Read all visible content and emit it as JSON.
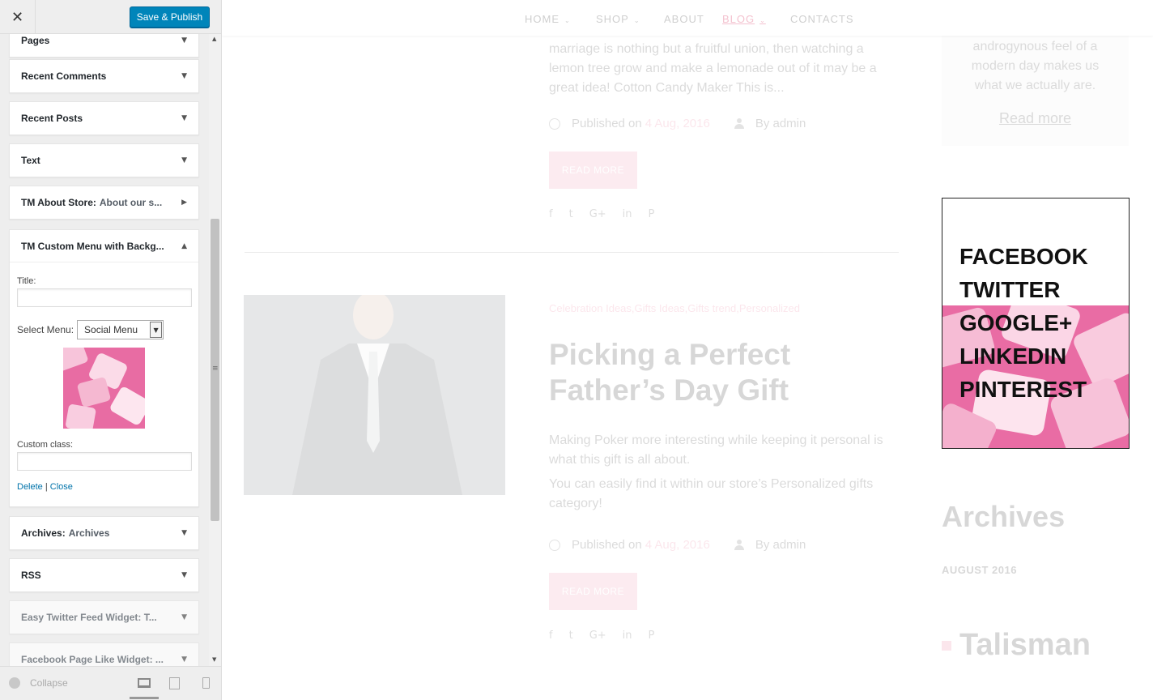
{
  "panel": {
    "close_label": "✕",
    "save_label": "Save & Publish",
    "widgets": {
      "pages": "Pages",
      "recent_comments": "Recent Comments",
      "recent_posts": "Recent Posts",
      "text": "Text",
      "tm_about_store": "TM About Store:",
      "tm_about_store_sub": "About our s...",
      "tm_custom_menu": "TM Custom Menu with Backg...",
      "archives": "Archives:",
      "archives_sub": "Archives",
      "rss": "RSS",
      "easy_twitter": "Easy Twitter Feed Widget: T...",
      "facebook_page": "Facebook Page Like Widget: ..."
    },
    "form": {
      "title_label": "Title:",
      "title_value": "",
      "select_menu_label": "Select Menu:",
      "select_menu_value": "Social Menu",
      "custom_class_label": "Custom class:",
      "custom_class_value": "",
      "delete_label": "Delete",
      "separator": "|",
      "close_label": "Close"
    },
    "footer": {
      "collapse_label": "Collapse"
    }
  },
  "site": {
    "nav": [
      {
        "label": "HOME",
        "has_dropdown": true
      },
      {
        "label": "SHOP",
        "has_dropdown": true
      },
      {
        "label": "ABOUT",
        "has_dropdown": false
      },
      {
        "label": "BLOG",
        "has_dropdown": true,
        "active": true
      },
      {
        "label": "CONTACTS",
        "has_dropdown": false
      }
    ],
    "post1": {
      "excerpt": "marriage is nothing but a fruitful union, then watching a lemon tree grow and make a lemonade out of it may be a great idea!  Cotton Candy Maker This is...",
      "published_label": "Published on",
      "date": "4 Aug, 2016",
      "author": "By admin",
      "read_more": "READ MORE"
    },
    "post2": {
      "categories": "Celebration Ideas,Gifts Ideas,Gifts trend,Personalized",
      "title": "Picking a Perfect Father’s Day Gift",
      "para1": "Making Poker more interesting while keeping it personal is what this gift is all about.",
      "para2": "You can easily find it within our store’s Personalized gifts category!",
      "published_label": "Published on",
      "date": "4 Aug, 2016",
      "author": "By admin",
      "read_more": "READ MORE"
    },
    "sidebar": {
      "about_text": "androgynous feel of a modern day makes us what we actually are.",
      "read_more": "Read more",
      "social_menu": [
        "FACEBOOK",
        "TWITTER",
        "GOOGLE+",
        "LINKEDIN",
        "PINTEREST"
      ],
      "archives_title": "Archives",
      "archives_item": "AUGUST 2016",
      "rss_title": "Talisman"
    }
  },
  "colors": {
    "accent_blue": "#0085ba",
    "link_blue": "#0073aa",
    "brand_pink": "#ea6b8d"
  }
}
